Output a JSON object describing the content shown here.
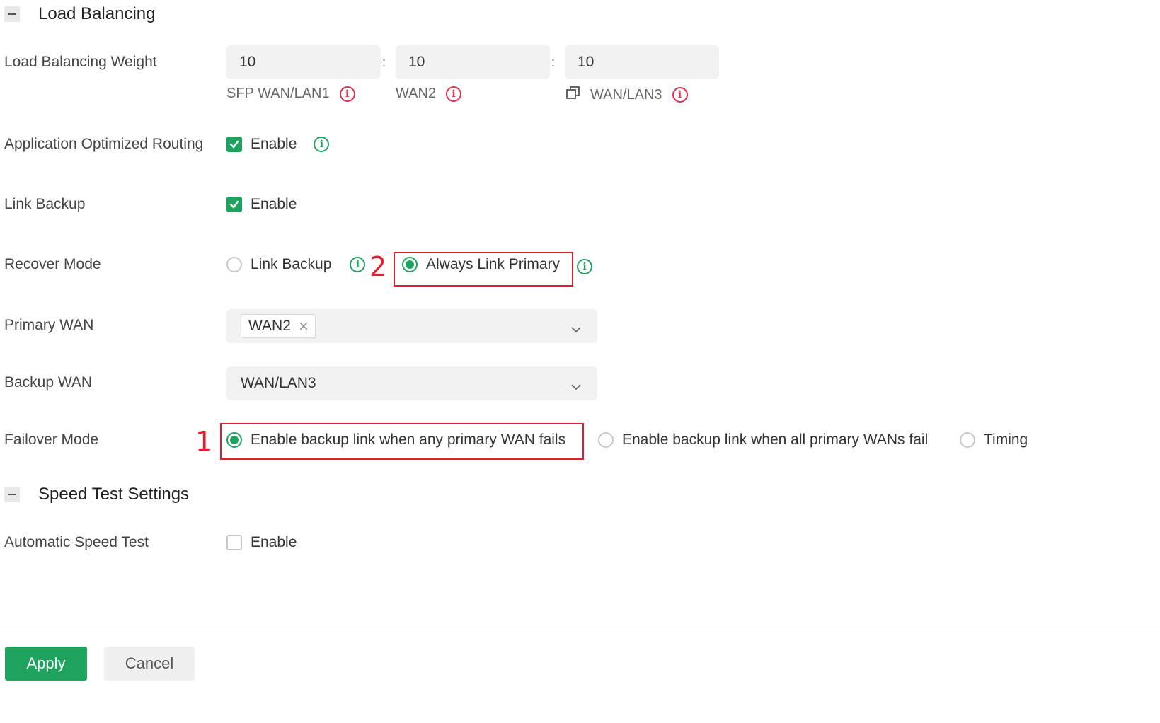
{
  "load_balancing": {
    "section_title": "Load Balancing",
    "weight_label": "Load Balancing Weight",
    "weights": [
      {
        "value": "10",
        "name": "SFP WAN/LAN1"
      },
      {
        "value": "10",
        "name": "WAN2"
      },
      {
        "value": "10",
        "name": "WAN/LAN3"
      }
    ],
    "separator": ":",
    "aor_label": "Application Optimized Routing",
    "aor_checkbox": "Enable",
    "aor_checked": true,
    "link_backup_label": "Link Backup",
    "link_backup_checkbox": "Enable",
    "link_backup_checked": true,
    "recover_mode_label": "Recover Mode",
    "recover_options": [
      "Link Backup",
      "Always Link Primary"
    ],
    "recover_selected": "Always Link Primary",
    "primary_wan_label": "Primary WAN",
    "primary_wan_tag": "WAN2",
    "backup_wan_label": "Backup WAN",
    "backup_wan_value": "WAN/LAN3",
    "failover_mode_label": "Failover Mode",
    "failover_options": [
      "Enable backup link when any primary WAN fails",
      "Enable backup link when all primary WANs fail",
      "Timing"
    ],
    "failover_selected": "Enable backup link when any primary WAN fails"
  },
  "speed_test": {
    "section_title": "Speed Test Settings",
    "auto_label": "Automatic Speed Test",
    "auto_checkbox": "Enable",
    "auto_checked": false
  },
  "annotations": {
    "one": "1",
    "two": "2"
  },
  "footer": {
    "apply": "Apply",
    "cancel": "Cancel"
  },
  "colors": {
    "accent": "#1ea35f",
    "warning_info": "#e0304e",
    "annotation": "#e0202e"
  },
  "icons": [
    "collapse-icon",
    "info-icon",
    "copy-icon",
    "check-icon",
    "chevron-down-icon",
    "close-icon"
  ]
}
